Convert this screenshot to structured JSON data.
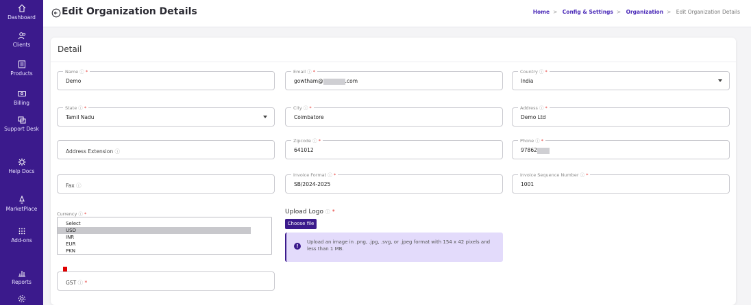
{
  "sidebar": {
    "items": [
      {
        "label": "Dashboard",
        "icon": "home-icon"
      },
      {
        "label": "Clients",
        "icon": "users-icon"
      },
      {
        "label": "Products",
        "icon": "products-icon"
      },
      {
        "label": "Billing",
        "icon": "billing-icon"
      },
      {
        "label": "Support Desk",
        "icon": "support-icon"
      },
      {
        "label": "Help Docs",
        "icon": "help-icon"
      },
      {
        "label": "MarketPlace",
        "icon": "marketplace-icon"
      },
      {
        "label": "Add-ons",
        "icon": "addons-icon"
      },
      {
        "label": "Reports",
        "icon": "reports-icon"
      },
      {
        "label": "",
        "icon": "settings-icon"
      }
    ]
  },
  "header": {
    "title": "Edit Organization Details",
    "breadcrumb": [
      "Home",
      "Config & Settings",
      "Organization",
      "Edit Organization Details"
    ]
  },
  "card": {
    "title": "Detail"
  },
  "fields": {
    "name": {
      "label": "Name",
      "value": "Demo"
    },
    "email": {
      "label": "Email",
      "value_prefix": "gowtham@",
      "value_suffix": ".com"
    },
    "country": {
      "label": "Country",
      "value": "India"
    },
    "state": {
      "label": "State",
      "value": "Tamil Nadu"
    },
    "city": {
      "label": "City",
      "value": "Coimbatore"
    },
    "address": {
      "label": "Address",
      "value": "Demo Ltd"
    },
    "address_ext": {
      "placeholder": "Address Extension"
    },
    "zipcode": {
      "label": "Zipcode",
      "value": "641012"
    },
    "phone": {
      "label": "Phone",
      "value": "97862"
    },
    "fax": {
      "placeholder": "Fax"
    },
    "invoice_format": {
      "label": "Invoice Format",
      "value": "SB/2024-2025"
    },
    "invoice_seq": {
      "label": "Invoice Sequence Number",
      "value": "1001"
    },
    "gst": {
      "placeholder": "GST"
    }
  },
  "currency": {
    "label": "Currency",
    "options": [
      "Select",
      "USD",
      "INR",
      "EUR",
      "PKN"
    ],
    "selected": "USD"
  },
  "upload": {
    "label": "Upload Logo",
    "button": "Choose file",
    "info": "Upload an image in .png, .jpg, .svg, or .jpeg format with 154 x 42 pixels and less than 1 MB."
  },
  "symbols": {
    "required": "*",
    "help": "ⓘ"
  },
  "colors": {
    "sidebar": "#3b1a8c",
    "accent": "#4b2bb8",
    "info_bg": "#e3dbfb",
    "required": "#e53935"
  }
}
